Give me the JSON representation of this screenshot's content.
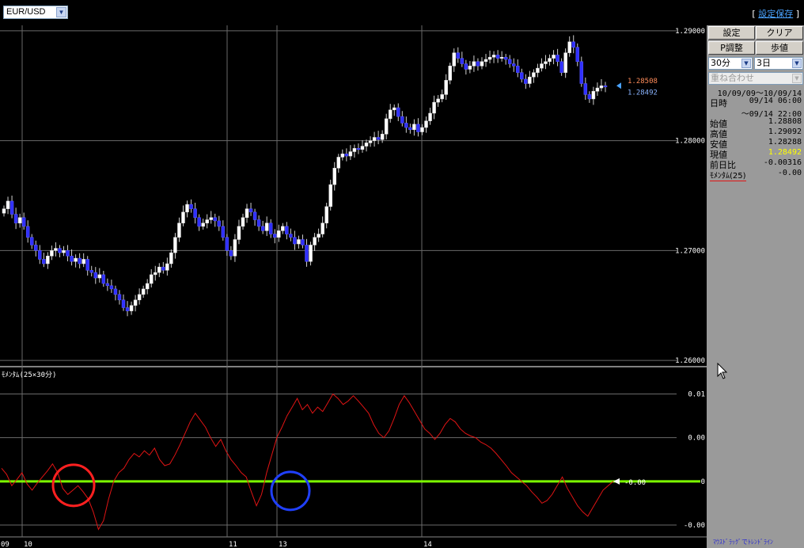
{
  "header": {
    "symbol": "EUR/USD",
    "save_label": "設定保存"
  },
  "panel": {
    "buttons": [
      "設定",
      "クリア",
      "P調整",
      "歩値"
    ],
    "interval": "30分",
    "span": "3日",
    "overlay": "重ね合わせ",
    "range": "10/09/09～10/09/14",
    "datetime_label": "日時",
    "datetime_from": "09/14 06:00",
    "datetime_to": "～09/14 22:00",
    "open_label": "始値",
    "open": "1.28808",
    "high_label": "高値",
    "high": "1.29092",
    "low_label": "安値",
    "low": "1.28288",
    "close_label": "現値",
    "close": "1.28492",
    "change_label": "前日比",
    "change": "-0.00316",
    "momentum_label": "ﾓﾒﾝﾀﾑ(25)",
    "momentum": "-0.00",
    "hint": "ﾏｳｽﾄﾞﾗｯｸﾞでﾄﾚﾝﾄﾞﾗｲﾝ"
  },
  "colors": {
    "bull": "#ffffff",
    "bear": "#3030ff",
    "momentum_line": "#e01414",
    "zero_line": "#7cfc00",
    "ask": "#ff8c5a",
    "bid": "#8ab4ff",
    "circle_red": "#ff2020",
    "circle_blue": "#2040ff",
    "current": "#ffff00"
  },
  "chart_data": [
    {
      "type": "candlestick",
      "title": "",
      "ylim": [
        1.2595,
        1.2905
      ],
      "yticks": [
        "1.29000",
        "1.28000",
        "1.27000",
        "1.26000"
      ],
      "x_labels": [
        "09",
        "10",
        "11",
        "13",
        "14"
      ],
      "last_ask": "1.28508",
      "last_bid": "1.28492",
      "close_series": [
        1.2738,
        1.2745,
        1.2733,
        1.2725,
        1.273,
        1.2722,
        1.2712,
        1.2705,
        1.27,
        1.2692,
        1.2688,
        1.2695,
        1.27,
        1.2702,
        1.2698,
        1.27,
        1.2695,
        1.269,
        1.2693,
        1.2688,
        1.2692,
        1.2682,
        1.268,
        1.2675,
        1.2678,
        1.267,
        1.2668,
        1.2665,
        1.266,
        1.2655,
        1.2648,
        1.2645,
        1.265,
        1.2655,
        1.266,
        1.2665,
        1.267,
        1.2678,
        1.268,
        1.2685,
        1.2682,
        1.2688,
        1.2698,
        1.2712,
        1.2725,
        1.2735,
        1.2742,
        1.2738,
        1.273,
        1.2722,
        1.2725,
        1.2728,
        1.273,
        1.2727,
        1.2722,
        1.2712,
        1.27,
        1.2695,
        1.271,
        1.2722,
        1.273,
        1.2738,
        1.2735,
        1.2728,
        1.2722,
        1.2718,
        1.2725,
        1.2715,
        1.2712,
        1.2718,
        1.2722,
        1.2715,
        1.2712,
        1.2706,
        1.271,
        1.2705,
        1.269,
        1.2705,
        1.2712,
        1.2715,
        1.2725,
        1.274,
        1.276,
        1.2775,
        1.2785,
        1.2788,
        1.2786,
        1.279,
        1.2793,
        1.2792,
        1.2795,
        1.2798,
        1.28,
        1.2803,
        1.2801,
        1.2806,
        1.282,
        1.2828,
        1.283,
        1.2822,
        1.2816,
        1.2812,
        1.281,
        1.2815,
        1.2808,
        1.2812,
        1.2818,
        1.2825,
        1.2835,
        1.2838,
        1.2842,
        1.2855,
        1.2868,
        1.288,
        1.2875,
        1.287,
        1.2865,
        1.2868,
        1.2872,
        1.2868,
        1.2872,
        1.2874,
        1.2876,
        1.2878,
        1.2875,
        1.2876,
        1.2874,
        1.287,
        1.2868,
        1.2862,
        1.2856,
        1.2852,
        1.2858,
        1.2862,
        1.2866,
        1.287,
        1.2872,
        1.2875,
        1.2878,
        1.2872,
        1.2862,
        1.288,
        1.289,
        1.2885,
        1.2872,
        1.2852,
        1.2842,
        1.2838,
        1.2845,
        1.2848,
        1.285,
        1.2849
      ]
    },
    {
      "type": "line",
      "title": "ﾓﾒﾝﾀﾑ(25×30分)",
      "yticks": [
        "0.01",
        "0.00",
        "0",
        "-0.00"
      ],
      "last_value": "-0.00",
      "values": [
        0.0015,
        0.0008,
        -0.0005,
        0.0002,
        0.001,
        -0.0003,
        -0.001,
        -0.0002,
        0.0005,
        0.0012,
        0.002,
        0.001,
        -0.0008,
        -0.0015,
        -0.001,
        -0.0005,
        -0.0012,
        -0.002,
        -0.0035,
        -0.0055,
        -0.0045,
        -0.002,
        0.0,
        0.001,
        0.0015,
        0.0025,
        0.0032,
        0.0028,
        0.0035,
        0.003,
        0.0038,
        0.0025,
        0.0018,
        0.002,
        0.003,
        0.0042,
        0.0055,
        0.0068,
        0.0078,
        0.007,
        0.0062,
        0.005,
        0.004,
        0.0048,
        0.0035,
        0.0025,
        0.0018,
        0.001,
        0.0005,
        -0.0012,
        -0.0028,
        -0.0015,
        0.001,
        0.003,
        0.005,
        0.0062,
        0.0075,
        0.0085,
        0.0095,
        0.0082,
        0.0088,
        0.0078,
        0.0085,
        0.008,
        0.009,
        0.01,
        0.0095,
        0.0088,
        0.0092,
        0.0098,
        0.0092,
        0.0085,
        0.0078,
        0.0065,
        0.0055,
        0.005,
        0.0058,
        0.0072,
        0.0088,
        0.0098,
        0.009,
        0.008,
        0.007,
        0.006,
        0.0055,
        0.0048,
        0.0055,
        0.0065,
        0.0072,
        0.0068,
        0.006,
        0.0055,
        0.0052,
        0.005,
        0.0045,
        0.0042,
        0.0038,
        0.0032,
        0.0025,
        0.0018,
        0.001,
        0.0005,
        0.0,
        -0.0005,
        -0.0012,
        -0.0018,
        -0.0025,
        -0.0022,
        -0.0015,
        -0.0005,
        0.0005,
        -0.0008,
        -0.0018,
        -0.0028,
        -0.0035,
        -0.004,
        -0.003,
        -0.002,
        -0.001,
        -0.0005,
        0.0
      ]
    }
  ]
}
